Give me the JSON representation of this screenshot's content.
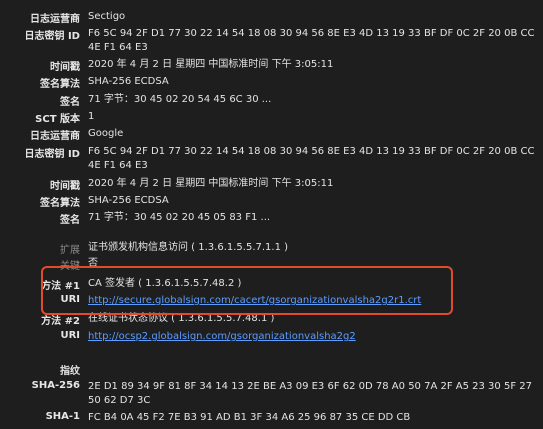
{
  "rows": [
    {
      "label": "日志运营商",
      "value": "Sectigo"
    },
    {
      "label": "日志密钥 ID",
      "value": "F6 5C 94 2F D1 77 30 22 14 54 18 08 30 94 56 8E E3 4D 13 19 33 BF DF 0C 2F 20 0B CC 4E F1 64 E3"
    },
    {
      "label": "时间戳",
      "value": "2020 年 4 月 2 日 星期四 中国标准时间 下午 3:05:11"
    },
    {
      "label": "签名算法",
      "value": "SHA-256 ECDSA"
    },
    {
      "label": "签名",
      "value": "71 字节：30 45 02 20 54 45 6C 30 ..."
    },
    {
      "label": "SCT 版本",
      "value": "1"
    },
    {
      "label": "日志运营商",
      "value": "Google"
    },
    {
      "label": "日志密钥 ID",
      "value": "F6 5C 94 2F D1 77 30 22 14 54 18 08 30 94 56 8E E3 4D 13 19 33 BF DF 0C 2F 20 0B CC 4E F1 64 E3"
    },
    {
      "label": "时间戳",
      "value": "2020 年 4 月 2 日 星期四 中国标准时间 下午 3:05:11"
    },
    {
      "label": "签名算法",
      "value": "SHA-256 ECDSA"
    },
    {
      "label": "签名",
      "value": "71 字节：30 45 02 20 45 05 83 F1 ..."
    }
  ],
  "extension": {
    "label": "扩展",
    "value": "证书颁发机构信息访问 ( 1.3.6.1.5.5.7.1.1 )",
    "critical_label": "关键",
    "critical_value": "否"
  },
  "method1": {
    "label": "方法 #1",
    "value": "CA 签发者 ( 1.3.6.1.5.5.7.48.2 )",
    "uri_label": "URI",
    "uri": "http://secure.globalsign.com/cacert/gsorganizationvalsha2g2r1.crt"
  },
  "method2": {
    "label": "方法 #2",
    "value": "在线证书状态协议 ( 1.3.6.1.5.5.7.48.1 )",
    "uri_label": "URI",
    "uri": "http://ocsp2.globalsign.com/gsorganizationvalsha2g2"
  },
  "fingerprints": {
    "heading": "指纹",
    "sha256_label": "SHA-256",
    "sha256": "2E D1 89 34 9F 81 8F 34 14 13 2E BE A3 09 E3 6F 62 0D 78 A0 50 7A 2F A5 23 30 5F 27 50 62 D7 3C",
    "sha1_label": "SHA-1",
    "sha1": "FC B4 0A 45 F2 7E B3 91 AD B1 3F 34 A6 25 96 87 35 CE DD CB"
  },
  "colors": {
    "background": "#1e1e1e",
    "link": "#5c9dff",
    "highlight": "#e24a2a"
  }
}
